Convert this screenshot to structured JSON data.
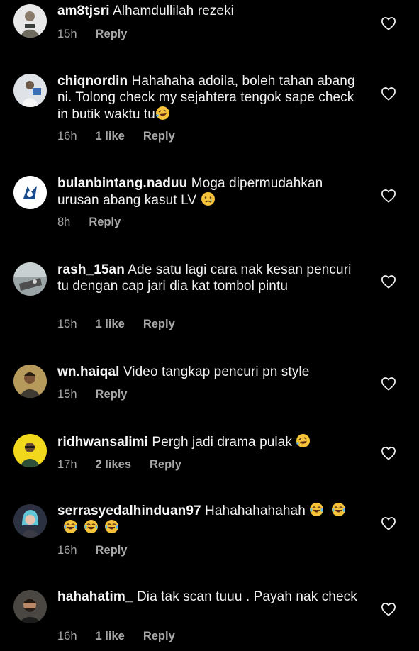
{
  "comments": [
    {
      "username": "am8tjsri",
      "text": "Alhamdullilah rezeki",
      "time": "15h",
      "likes": "",
      "reply": "Reply"
    },
    {
      "username": "chiqnordin",
      "text": "Hahahaha adoila, boleh tahan abang ni. Tolong check my sejahtera tengok sape check in butik waktu tu",
      "emoji": "rofl-emoji",
      "time": "16h",
      "likes": "1 like",
      "reply": "Reply"
    },
    {
      "username": "bulanbintang.naduu",
      "text": "Moga dipermudahkan urusan abang kasut LV",
      "emoji": "crying-emoji",
      "time": "8h",
      "likes": "",
      "reply": "Reply"
    },
    {
      "username": "rash_15an",
      "text": "Ade satu lagi cara nak kesan pencuri tu dengan cap jari dia kat tombol pintu",
      "time": "15h",
      "likes": "1 like",
      "reply": "Reply"
    },
    {
      "username": "wn.haiqal",
      "text": "Video tangkap pencuri pn style",
      "time": "15h",
      "likes": "",
      "reply": "Reply"
    },
    {
      "username": "ridhwansalimi",
      "text": "Pergh jadi drama pulak",
      "emoji": "rofl-emoji",
      "time": "17h",
      "likes": "2 likes",
      "reply": "Reply"
    },
    {
      "username": "serrasyedalhinduan97",
      "text": "Hahahahahahah",
      "emoji": "tears-of-joy-emoji x5",
      "time": "16h",
      "likes": "",
      "reply": "Reply"
    },
    {
      "username": "hahahatim_",
      "text": "Dia tak scan tuuu . Payah nak check",
      "time": "16h",
      "likes": "1 like",
      "reply": "Reply"
    }
  ],
  "colors": {
    "background": "#000000",
    "text": "#f2f2f2",
    "meta": "#a8a8a8",
    "heart_outline": "#f2f2f2"
  },
  "icons": {
    "like": "heart-outline-icon"
  }
}
